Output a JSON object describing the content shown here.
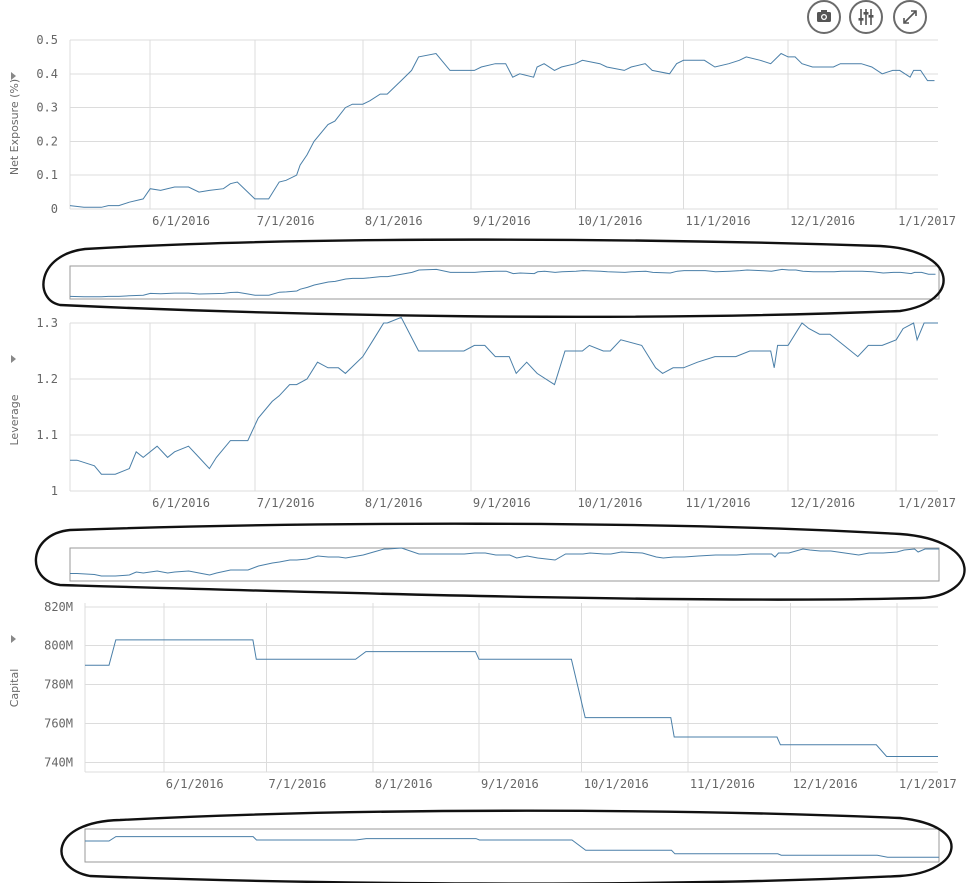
{
  "toolbar": {
    "buttons": [
      {
        "id": "snapshot",
        "icon": "camera-icon"
      },
      {
        "id": "adjust",
        "icon": "sliders-icon"
      },
      {
        "id": "expand",
        "icon": "expand-icon"
      }
    ]
  },
  "colors": {
    "series": "#4a7fa8",
    "grid": "#dcdcdc",
    "annotation": "#111111"
  },
  "chart_data": [
    {
      "type": "line",
      "ylabel": "Net Exposure (%)",
      "ylim": [
        0,
        0.5
      ],
      "yticks": [
        "0",
        "0.1",
        "0.2",
        "0.3",
        "0.4",
        "0.5"
      ],
      "xlim": [
        "2016-05-09",
        "2017-01-13"
      ],
      "xticks": [
        "6/1/2016",
        "7/1/2016",
        "8/1/2016",
        "9/1/2016",
        "10/1/2016",
        "11/1/2016",
        "12/1/2016",
        "1/1/2017"
      ],
      "grid": true,
      "legend": "none",
      "navigator": true,
      "series": [
        {
          "x": [
            "2016-05-09",
            "2016-05-13",
            "2016-05-18",
            "2016-05-20",
            "2016-05-23",
            "2016-05-26",
            "2016-05-30",
            "2016-06-01",
            "2016-06-04",
            "2016-06-08",
            "2016-06-12",
            "2016-06-15",
            "2016-06-18",
            "2016-06-22",
            "2016-06-24",
            "2016-06-26",
            "2016-06-29",
            "2016-07-01",
            "2016-07-05",
            "2016-07-08",
            "2016-07-10",
            "2016-07-13",
            "2016-07-14",
            "2016-07-16",
            "2016-07-18",
            "2016-07-22",
            "2016-07-24",
            "2016-07-27",
            "2016-07-29",
            "2016-08-01",
            "2016-08-03",
            "2016-08-06",
            "2016-08-08",
            "2016-08-12",
            "2016-08-15",
            "2016-08-17",
            "2016-08-22",
            "2016-08-26",
            "2016-08-29",
            "2016-09-02",
            "2016-09-04",
            "2016-09-08",
            "2016-09-09",
            "2016-09-11",
            "2016-09-13",
            "2016-09-15",
            "2016-09-19",
            "2016-09-20",
            "2016-09-22",
            "2016-09-25",
            "2016-09-27",
            "2016-10-01",
            "2016-10-03",
            "2016-10-08",
            "2016-10-10",
            "2016-10-15",
            "2016-10-17",
            "2016-10-21",
            "2016-10-23",
            "2016-10-28",
            "2016-10-30",
            "2016-11-01",
            "2016-11-07",
            "2016-11-10",
            "2016-11-14",
            "2016-11-17",
            "2016-11-19",
            "2016-11-23",
            "2016-11-26",
            "2016-11-29",
            "2016-12-01",
            "2016-12-03",
            "2016-12-05",
            "2016-12-08",
            "2016-12-11",
            "2016-12-14",
            "2016-12-16",
            "2016-12-22",
            "2016-12-25",
            "2016-12-28",
            "2016-12-31",
            "2017-01-02",
            "2017-01-05",
            "2017-01-06",
            "2017-01-08",
            "2017-01-10",
            "2017-01-12"
          ],
          "values": [
            0.01,
            0.005,
            0.005,
            0.01,
            0.01,
            0.02,
            0.03,
            0.06,
            0.055,
            0.065,
            0.065,
            0.05,
            0.055,
            0.06,
            0.075,
            0.08,
            0.05,
            0.03,
            0.03,
            0.08,
            0.085,
            0.1,
            0.13,
            0.16,
            0.2,
            0.25,
            0.26,
            0.3,
            0.31,
            0.31,
            0.32,
            0.34,
            0.34,
            0.38,
            0.41,
            0.45,
            0.46,
            0.41,
            0.41,
            0.41,
            0.42,
            0.43,
            0.43,
            0.43,
            0.39,
            0.4,
            0.39,
            0.42,
            0.43,
            0.41,
            0.42,
            0.43,
            0.44,
            0.43,
            0.42,
            0.41,
            0.42,
            0.43,
            0.41,
            0.4,
            0.43,
            0.44,
            0.44,
            0.42,
            0.43,
            0.44,
            0.45,
            0.44,
            0.43,
            0.46,
            0.45,
            0.45,
            0.43,
            0.42,
            0.42,
            0.42,
            0.43,
            0.43,
            0.42,
            0.4,
            0.41,
            0.41,
            0.39,
            0.41,
            0.41,
            0.38,
            0.38
          ]
        }
      ]
    },
    {
      "type": "line",
      "ylabel": "Leverage",
      "ylim": [
        1,
        1.3
      ],
      "yticks": [
        "1",
        "1.1",
        "1.2",
        "1.3"
      ],
      "xlim": [
        "2016-05-09",
        "2017-01-13"
      ],
      "xticks": [
        "6/1/2016",
        "7/1/2016",
        "8/1/2016",
        "9/1/2016",
        "10/1/2016",
        "11/1/2016",
        "12/1/2016",
        "1/1/2017"
      ],
      "grid": true,
      "legend": "none",
      "navigator": true,
      "series": [
        {
          "x": [
            "2016-05-09",
            "2016-05-11",
            "2016-05-16",
            "2016-05-18",
            "2016-05-20",
            "2016-05-22",
            "2016-05-26",
            "2016-05-28",
            "2016-05-30",
            "2016-06-03",
            "2016-06-06",
            "2016-06-08",
            "2016-06-12",
            "2016-06-15",
            "2016-06-18",
            "2016-06-20",
            "2016-06-24",
            "2016-06-26",
            "2016-06-29",
            "2016-07-02",
            "2016-07-06",
            "2016-07-08",
            "2016-07-11",
            "2016-07-13",
            "2016-07-16",
            "2016-07-19",
            "2016-07-22",
            "2016-07-25",
            "2016-07-27",
            "2016-08-01",
            "2016-08-04",
            "2016-08-07",
            "2016-08-08",
            "2016-08-12",
            "2016-08-17",
            "2016-08-21",
            "2016-08-25",
            "2016-08-30",
            "2016-09-02",
            "2016-09-05",
            "2016-09-08",
            "2016-09-12",
            "2016-09-14",
            "2016-09-17",
            "2016-09-20",
            "2016-09-25",
            "2016-09-28",
            "2016-10-03",
            "2016-10-05",
            "2016-10-09",
            "2016-10-11",
            "2016-10-14",
            "2016-10-20",
            "2016-10-24",
            "2016-10-26",
            "2016-10-29",
            "2016-11-01",
            "2016-11-05",
            "2016-11-10",
            "2016-11-16",
            "2016-11-20",
            "2016-11-26",
            "2016-11-27",
            "2016-11-28",
            "2016-12-01",
            "2016-12-05",
            "2016-12-07",
            "2016-12-10",
            "2016-12-13",
            "2016-12-17",
            "2016-12-21",
            "2016-12-24",
            "2016-12-28",
            "2017-01-01",
            "2017-01-03",
            "2017-01-06",
            "2017-01-07",
            "2017-01-09",
            "2017-01-13"
          ],
          "values": [
            1.055,
            1.055,
            1.045,
            1.03,
            1.03,
            1.03,
            1.04,
            1.07,
            1.06,
            1.08,
            1.06,
            1.07,
            1.08,
            1.06,
            1.04,
            1.06,
            1.09,
            1.09,
            1.09,
            1.13,
            1.16,
            1.17,
            1.19,
            1.19,
            1.2,
            1.23,
            1.22,
            1.22,
            1.21,
            1.24,
            1.27,
            1.3,
            1.3,
            1.31,
            1.25,
            1.25,
            1.25,
            1.25,
            1.26,
            1.26,
            1.24,
            1.24,
            1.21,
            1.23,
            1.21,
            1.19,
            1.25,
            1.25,
            1.26,
            1.25,
            1.25,
            1.27,
            1.26,
            1.22,
            1.21,
            1.22,
            1.22,
            1.23,
            1.24,
            1.24,
            1.25,
            1.25,
            1.22,
            1.26,
            1.26,
            1.3,
            1.29,
            1.28,
            1.28,
            1.26,
            1.24,
            1.26,
            1.26,
            1.27,
            1.29,
            1.3,
            1.27,
            1.3,
            1.3
          ]
        }
      ]
    },
    {
      "type": "line",
      "ylabel": "Capital",
      "ylim": [
        735,
        822
      ],
      "yticks": [
        "740M",
        "760M",
        "780M",
        "800M",
        "820M"
      ],
      "xlim": [
        "2016-05-09",
        "2017-01-13"
      ],
      "xticks": [
        "6/1/2016",
        "7/1/2016",
        "8/1/2016",
        "9/1/2016",
        "10/1/2016",
        "11/1/2016",
        "12/1/2016",
        "1/1/2017"
      ],
      "grid": true,
      "legend": "none",
      "navigator": true,
      "series": [
        {
          "x": [
            "2016-05-09",
            "2016-05-16",
            "2016-05-18",
            "2016-06-27",
            "2016-06-28",
            "2016-07-27",
            "2016-07-30",
            "2016-08-31",
            "2016-09-01",
            "2016-09-28",
            "2016-10-02",
            "2016-10-27",
            "2016-10-28",
            "2016-11-27",
            "2016-11-28",
            "2016-12-26",
            "2016-12-29",
            "2017-01-13"
          ],
          "values": [
            790,
            790,
            803,
            803,
            793,
            793,
            797,
            797,
            793,
            793,
            763,
            763,
            753,
            753,
            749,
            749,
            743,
            743
          ]
        }
      ]
    }
  ]
}
